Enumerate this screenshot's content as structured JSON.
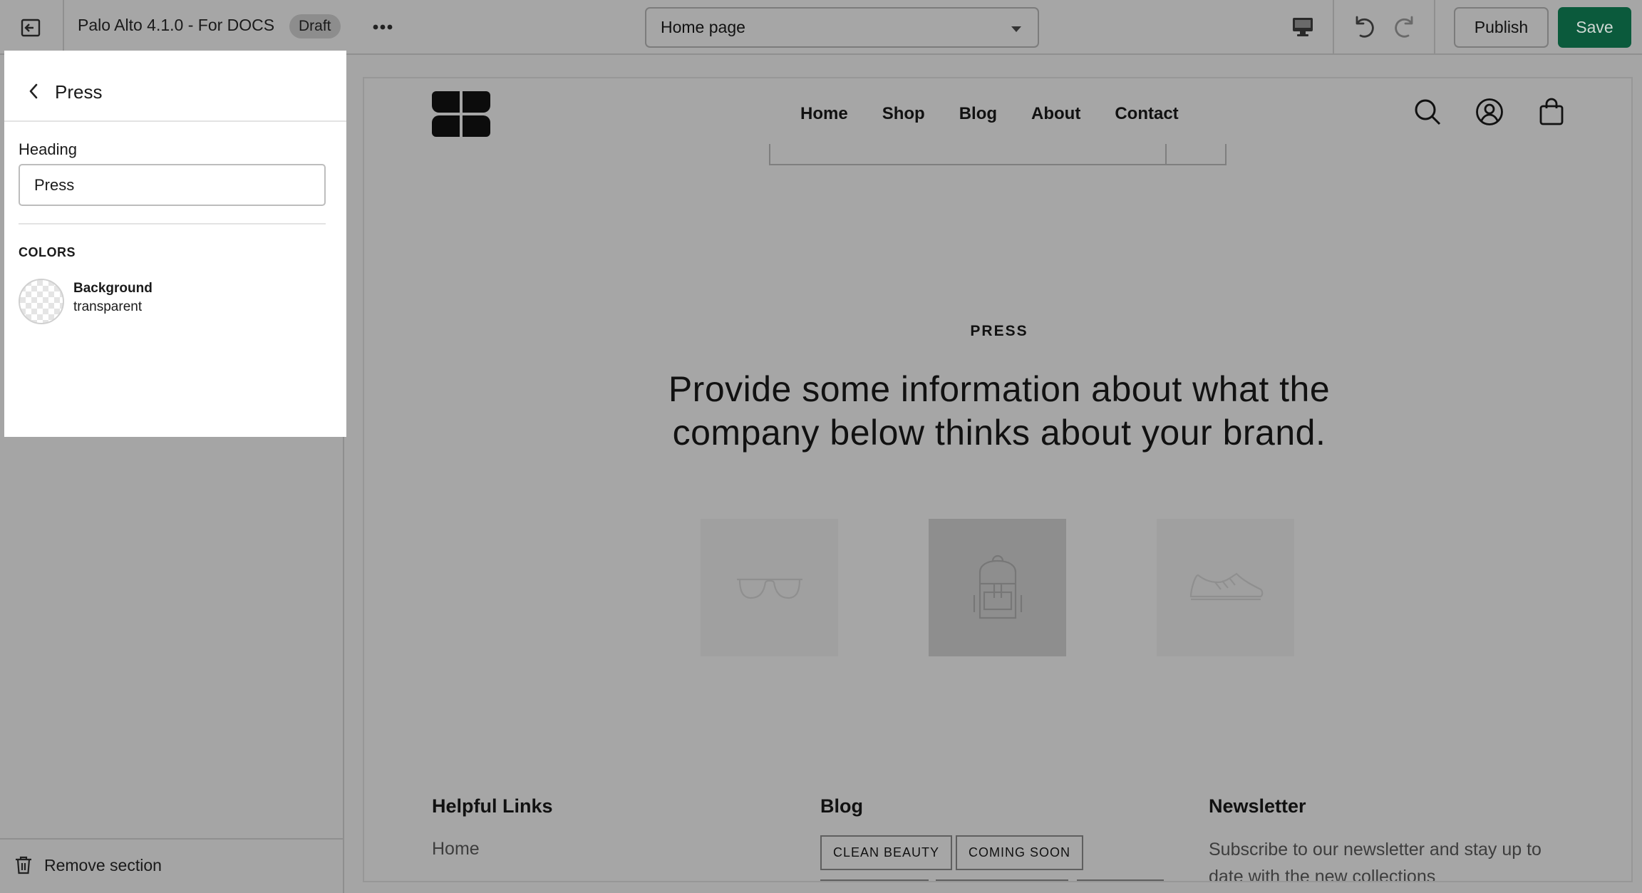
{
  "topbar": {
    "store_name": "Palo Alto 4.1.0 - For DOCS",
    "draft_badge": "Draft",
    "page_selector": "Home page",
    "publish_label": "Publish",
    "save_label": "Save"
  },
  "panel": {
    "title": "Press",
    "heading_label": "Heading",
    "heading_value": "Press",
    "colors_heading": "COLORS",
    "background_label": "Background",
    "background_value": "transparent"
  },
  "sidebar": {
    "remove_section_label": "Remove section"
  },
  "preview": {
    "nav": [
      "Home",
      "Shop",
      "Blog",
      "About",
      "Contact"
    ],
    "press_kicker": "PRESS",
    "press_heading": "Provide some information about what the company below thinks about your brand.",
    "press_logos": [
      "glasses-icon",
      "backpack-icon",
      "sneaker-icon"
    ],
    "footer": {
      "helpful_links_title": "Helpful Links",
      "helpful_links": [
        "Home"
      ],
      "blog_title": "Blog",
      "blog_tags": [
        "CLEAN BEAUTY",
        "COMING SOON"
      ],
      "newsletter_title": "Newsletter",
      "newsletter_text": "Subscribe to our newsletter and stay up to date with the new collections"
    }
  },
  "colors": {
    "save_button": "#0b5a3c",
    "overlay_gray": "#a6a6a6",
    "panel_white": "#ffffff"
  }
}
